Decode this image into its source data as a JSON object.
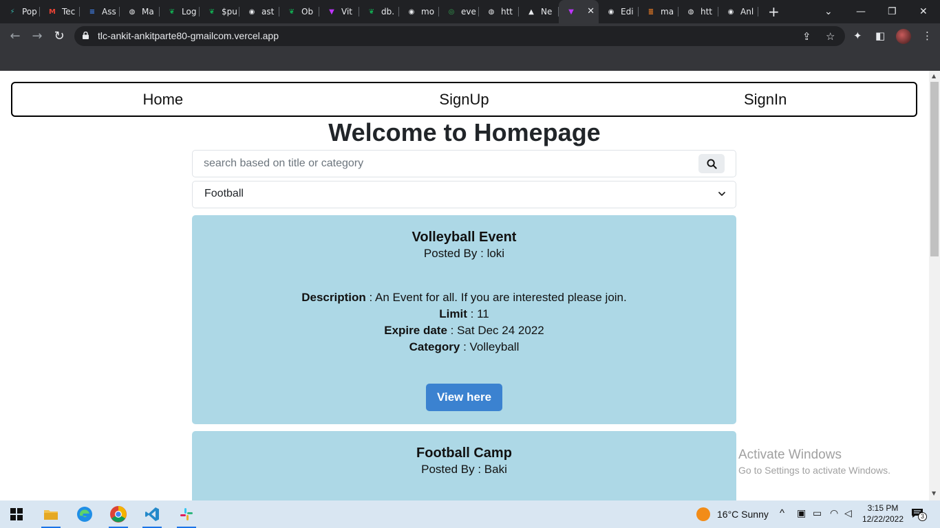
{
  "browser": {
    "tabs": [
      {
        "label": "Pop",
        "icon": "lightning-icon",
        "color": "#36b3a8"
      },
      {
        "label": "Tec",
        "icon": "gmail-icon",
        "color": "#ea4335"
      },
      {
        "label": "Ass",
        "icon": "docs-icon",
        "color": "#4285f4"
      },
      {
        "label": "Ma",
        "icon": "globe-icon",
        "color": "#e8eaed"
      },
      {
        "label": "Log",
        "icon": "mongodb-icon",
        "color": "#13aa52"
      },
      {
        "label": "$pu",
        "icon": "mongodb-icon",
        "color": "#13aa52"
      },
      {
        "label": "ast",
        "icon": "github-icon",
        "color": "#e8eaed"
      },
      {
        "label": "Ob",
        "icon": "mongodb-icon",
        "color": "#13aa52"
      },
      {
        "label": "Vit",
        "icon": "vite-icon",
        "color": "#bd34fe"
      },
      {
        "label": "db.",
        "icon": "mongodb-icon",
        "color": "#13aa52"
      },
      {
        "label": "mo",
        "icon": "github-icon",
        "color": "#e8eaed"
      },
      {
        "label": "eve",
        "icon": "globe-green-icon",
        "color": "#34a853"
      },
      {
        "label": "htt",
        "icon": "globe-icon",
        "color": "#e8eaed"
      },
      {
        "label": "Ne",
        "icon": "triangle-icon",
        "color": "#e8eaed"
      },
      {
        "label": "",
        "icon": "vite-icon",
        "color": "#bd34fe",
        "active": true
      },
      {
        "label": "Edi",
        "icon": "github-icon",
        "color": "#e8eaed"
      },
      {
        "label": "ma",
        "icon": "stackoverflow-icon",
        "color": "#f48024"
      },
      {
        "label": "htt",
        "icon": "globe-icon",
        "color": "#e8eaed"
      },
      {
        "label": "Anl",
        "icon": "github-icon",
        "color": "#e8eaed"
      }
    ],
    "url": "tlc-ankit-ankitparte80-gmailcom.vercel.app"
  },
  "nav": {
    "home": "Home",
    "signup": "SignUp",
    "signin": "SignIn"
  },
  "page": {
    "heading": "Welcome to Homepage",
    "search_placeholder": "search based on title or category",
    "selected_category": "Football"
  },
  "events": [
    {
      "title": "Volleyball Event",
      "posted_label": "Posted By :",
      "posted_by": "loki",
      "description_label": "Description",
      "description": "An Event for all. If you are interested please join.",
      "limit_label": "Limit",
      "limit": "11",
      "expire_label": "Expire date",
      "expire": "Sat Dec 24 2022",
      "category_label": "Category",
      "category": "Volleyball",
      "button": "View here"
    },
    {
      "title": "Football Camp",
      "posted_label": "Posted By :",
      "posted_by": "Baki"
    }
  ],
  "watermark": {
    "title": "Activate Windows",
    "subtitle": "Go to Settings to activate Windows."
  },
  "taskbar": {
    "weather": "16°C  Sunny",
    "time": "3:15 PM",
    "date": "12/22/2022",
    "notifications": "3"
  }
}
